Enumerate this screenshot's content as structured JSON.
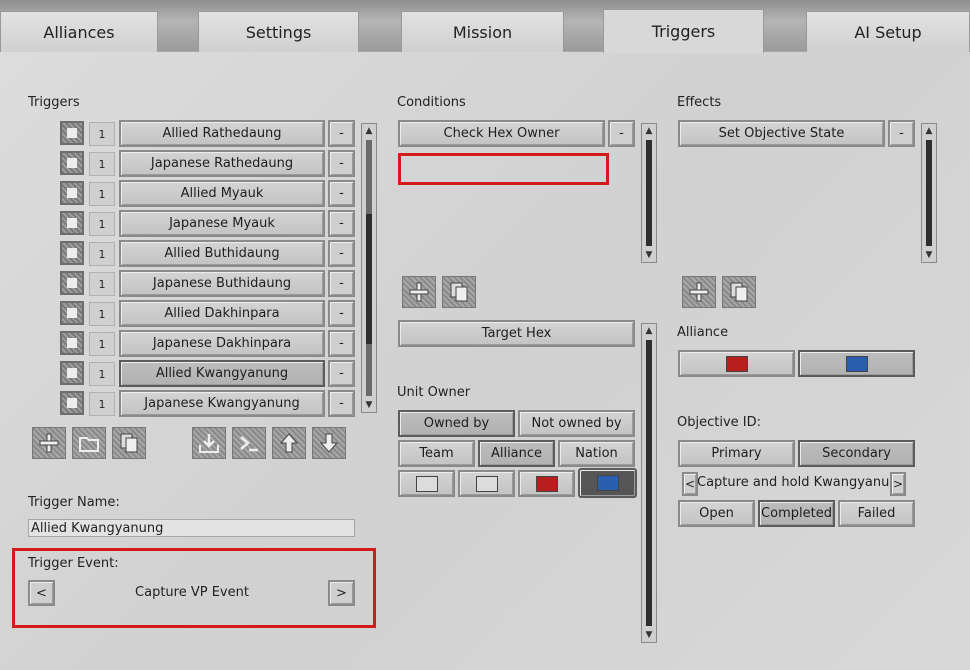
{
  "tabs": [
    "Alliances",
    "Settings",
    "Mission",
    "Triggers",
    "AI Setup"
  ],
  "triggers": {
    "label": "Triggers",
    "items": [
      {
        "count": "1",
        "name": "Allied Rathedaung"
      },
      {
        "count": "1",
        "name": "Japanese Rathedaung"
      },
      {
        "count": "1",
        "name": "Allied Myauk"
      },
      {
        "count": "1",
        "name": "Japanese Myauk"
      },
      {
        "count": "1",
        "name": "Allied Buthidaung"
      },
      {
        "count": "1",
        "name": "Japanese Buthidaung"
      },
      {
        "count": "1",
        "name": "Allied Dakhinpara"
      },
      {
        "count": "1",
        "name": "Japanese Dakhinpara"
      },
      {
        "count": "1",
        "name": "Allied Kwangyanung"
      },
      {
        "count": "1",
        "name": "Japanese Kwangyanung"
      }
    ],
    "remove_label": "-"
  },
  "trigger_name": {
    "label": "Trigger Name:",
    "value": "Allied Kwangyanung"
  },
  "trigger_event": {
    "label": "Trigger Event:",
    "value": "Capture VP Event",
    "prev": "<",
    "next": ">"
  },
  "conditions": {
    "label": "Conditions",
    "item": "Check Hex Owner",
    "remove_label": "-",
    "target_hex": "Target Hex",
    "unit_owner_label": "Unit Owner",
    "owned_by": "Owned by",
    "not_owned_by": "Not owned by",
    "team": "Team",
    "alliance": "Alliance",
    "nation": "Nation"
  },
  "effects": {
    "label": "Effects",
    "item": "Set Objective State",
    "remove_label": "-",
    "alliance_label": "Alliance",
    "objective_id_label": "Objective ID:",
    "primary": "Primary",
    "secondary": "Secondary",
    "objective_text": "Capture and hold Kwangyanung.",
    "prev": "<",
    "next": ">",
    "open": "Open",
    "completed": "Completed",
    "failed": "Failed"
  },
  "colors": {
    "red": "#b81e1e",
    "blue": "#2a5fb0",
    "white": "#dcdcdc",
    "highlight": "#d21b1b"
  }
}
